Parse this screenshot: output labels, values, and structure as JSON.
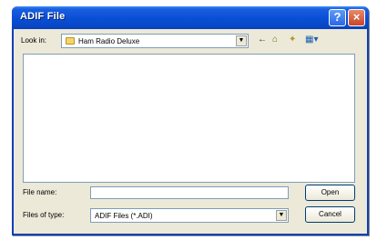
{
  "window": {
    "title": "ADIF File"
  },
  "title_buttons": {
    "help_label": "?",
    "close_label": "×"
  },
  "look_in": {
    "label": "Look in:",
    "value": "Ham Radio Deluxe",
    "icon": "folder-icon"
  },
  "toolbar": {
    "back_icon": "←",
    "up_icon": "⌂",
    "new_folder_icon": "✦",
    "view_icon": "▦▾"
  },
  "file_name": {
    "label": "File name:",
    "value": ""
  },
  "file_type": {
    "label": "Files of type:",
    "value": "ADIF Files (*.ADI)"
  },
  "buttons": {
    "open_label": "Open",
    "cancel_label": "Cancel"
  },
  "dropdown_arrow": "▼"
}
